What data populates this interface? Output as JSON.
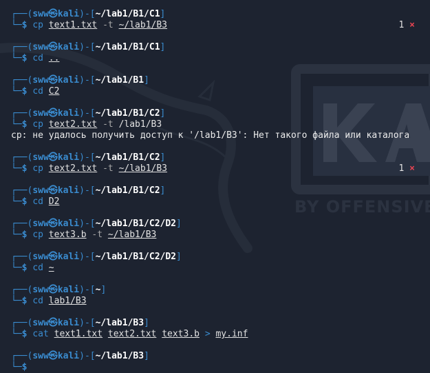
{
  "prompt": {
    "frame_top": "┌──(",
    "frame_mid": ")-[",
    "frame_end": "]",
    "frame_bottom": "└─",
    "user": "sww",
    "skull_icon": "㉿",
    "host": "kali",
    "dollar": "$"
  },
  "watermark": {
    "text": "BY OFFENSIVE",
    "icon": "kali-dragon-icon",
    "color": "#2b3240"
  },
  "colors": {
    "background": "#1d2330",
    "prompt_blue": "#3a8cd0",
    "error_red": "#e84452",
    "text": "#e2e2e2"
  },
  "blocks": [
    {
      "path": "~/lab1/B1/C1",
      "cmd": "cp",
      "args": [
        {
          "text": "text1.txt",
          "type": "arg"
        },
        {
          "text": "-t",
          "type": "opt"
        },
        {
          "text": "~/lab1/B3",
          "type": "arg"
        }
      ],
      "status": {
        "code": "1",
        "mark": "×"
      }
    },
    {
      "path": "~/lab1/B1/C1",
      "cmd": "cd",
      "args": [
        {
          "text": "..",
          "type": "arg"
        }
      ]
    },
    {
      "path": "~/lab1/B1",
      "cmd": "cd",
      "args": [
        {
          "text": "C2",
          "type": "arg"
        }
      ]
    },
    {
      "path": "~/lab1/B1/C2",
      "cmd": "cp",
      "args": [
        {
          "text": "text2.txt",
          "type": "arg"
        },
        {
          "text": "-t",
          "type": "opt"
        },
        {
          "text": "/lab1/B3",
          "type": "plain"
        }
      ],
      "output": "cp: не удалось получить доступ к '/lab1/B3': Нет такого файла или каталога"
    },
    {
      "path": "~/lab1/B1/C2",
      "cmd": "cp",
      "args": [
        {
          "text": "text2.txt",
          "type": "arg"
        },
        {
          "text": "-t",
          "type": "opt"
        },
        {
          "text": "~/lab1/B3",
          "type": "arg"
        }
      ],
      "status": {
        "code": "1",
        "mark": "×"
      }
    },
    {
      "path": "~/lab1/B1/C2",
      "cmd": "cd",
      "args": [
        {
          "text": "D2",
          "type": "arg"
        }
      ]
    },
    {
      "path": "~/lab1/B1/C2/D2",
      "cmd": "cp",
      "args": [
        {
          "text": "text3.b",
          "type": "arg"
        },
        {
          "text": "-t",
          "type": "opt"
        },
        {
          "text": "~/lab1/B3",
          "type": "arg"
        }
      ]
    },
    {
      "path": "~/lab1/B1/C2/D2",
      "cmd": "cd",
      "args": [
        {
          "text": "~",
          "type": "arg"
        }
      ]
    },
    {
      "path": "~",
      "cmd": "cd",
      "args": [
        {
          "text": "lab1/B3",
          "type": "arg"
        }
      ]
    },
    {
      "path": "~/lab1/B3",
      "cmd": "cat",
      "args": [
        {
          "text": "text1.txt",
          "type": "arg"
        },
        {
          "text": "text2.txt",
          "type": "arg"
        },
        {
          "text": "text3.b",
          "type": "arg"
        },
        {
          "text": ">",
          "type": "redir"
        },
        {
          "text": "my.inf",
          "type": "arg"
        }
      ]
    },
    {
      "path": "~/lab1/B3"
    }
  ]
}
